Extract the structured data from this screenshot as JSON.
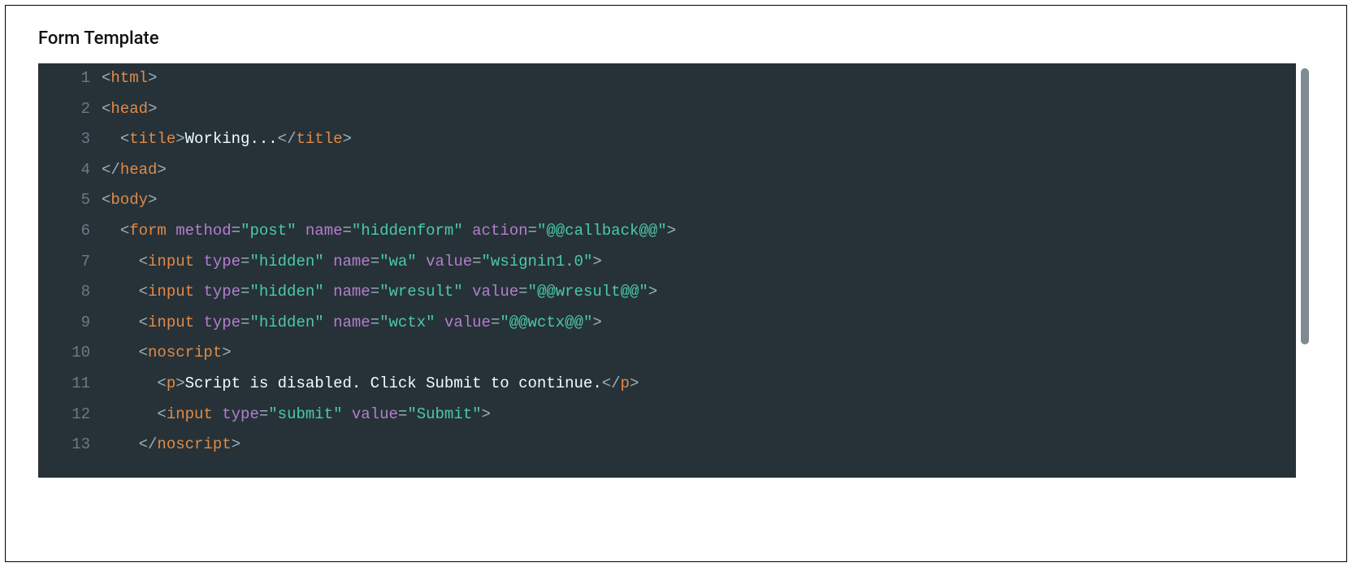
{
  "section_title": "Form Template",
  "code": {
    "lines": [
      {
        "n": "1",
        "indent": 0,
        "tokens": [
          {
            "c": "punct",
            "t": "<"
          },
          {
            "c": "tag",
            "t": "html"
          },
          {
            "c": "punct",
            "t": ">"
          }
        ]
      },
      {
        "n": "2",
        "indent": 0,
        "tokens": [
          {
            "c": "punct",
            "t": "<"
          },
          {
            "c": "tag",
            "t": "head"
          },
          {
            "c": "punct",
            "t": ">"
          }
        ]
      },
      {
        "n": "3",
        "indent": 2,
        "tokens": [
          {
            "c": "punct",
            "t": "<"
          },
          {
            "c": "tag",
            "t": "title"
          },
          {
            "c": "punct",
            "t": ">"
          },
          {
            "c": "text",
            "t": "Working..."
          },
          {
            "c": "punct",
            "t": "</"
          },
          {
            "c": "tag",
            "t": "title"
          },
          {
            "c": "punct",
            "t": ">"
          }
        ]
      },
      {
        "n": "4",
        "indent": 0,
        "tokens": [
          {
            "c": "punct",
            "t": "</"
          },
          {
            "c": "tag",
            "t": "head"
          },
          {
            "c": "punct",
            "t": ">"
          }
        ]
      },
      {
        "n": "5",
        "indent": 0,
        "tokens": [
          {
            "c": "punct",
            "t": "<"
          },
          {
            "c": "tag",
            "t": "body"
          },
          {
            "c": "punct",
            "t": ">"
          }
        ]
      },
      {
        "n": "6",
        "indent": 2,
        "tokens": [
          {
            "c": "punct",
            "t": "<"
          },
          {
            "c": "tag",
            "t": "form"
          },
          {
            "c": "text",
            "t": " "
          },
          {
            "c": "attr",
            "t": "method"
          },
          {
            "c": "punct",
            "t": "="
          },
          {
            "c": "string",
            "t": "\"post\""
          },
          {
            "c": "text",
            "t": " "
          },
          {
            "c": "attr",
            "t": "name"
          },
          {
            "c": "punct",
            "t": "="
          },
          {
            "c": "string",
            "t": "\"hiddenform\""
          },
          {
            "c": "text",
            "t": " "
          },
          {
            "c": "attr",
            "t": "action"
          },
          {
            "c": "punct",
            "t": "="
          },
          {
            "c": "string",
            "t": "\"@@callback@@\""
          },
          {
            "c": "punct",
            "t": ">"
          }
        ]
      },
      {
        "n": "7",
        "indent": 4,
        "tokens": [
          {
            "c": "punct",
            "t": "<"
          },
          {
            "c": "tag",
            "t": "input"
          },
          {
            "c": "text",
            "t": " "
          },
          {
            "c": "attr",
            "t": "type"
          },
          {
            "c": "punct",
            "t": "="
          },
          {
            "c": "string",
            "t": "\"hidden\""
          },
          {
            "c": "text",
            "t": " "
          },
          {
            "c": "attr",
            "t": "name"
          },
          {
            "c": "punct",
            "t": "="
          },
          {
            "c": "string",
            "t": "\"wa\""
          },
          {
            "c": "text",
            "t": " "
          },
          {
            "c": "attr",
            "t": "value"
          },
          {
            "c": "punct",
            "t": "="
          },
          {
            "c": "string",
            "t": "\"wsignin1.0\""
          },
          {
            "c": "punct",
            "t": ">"
          }
        ]
      },
      {
        "n": "8",
        "indent": 4,
        "tokens": [
          {
            "c": "punct",
            "t": "<"
          },
          {
            "c": "tag",
            "t": "input"
          },
          {
            "c": "text",
            "t": " "
          },
          {
            "c": "attr",
            "t": "type"
          },
          {
            "c": "punct",
            "t": "="
          },
          {
            "c": "string",
            "t": "\"hidden\""
          },
          {
            "c": "text",
            "t": " "
          },
          {
            "c": "attr",
            "t": "name"
          },
          {
            "c": "punct",
            "t": "="
          },
          {
            "c": "string",
            "t": "\"wresult\""
          },
          {
            "c": "text",
            "t": " "
          },
          {
            "c": "attr",
            "t": "value"
          },
          {
            "c": "punct",
            "t": "="
          },
          {
            "c": "string",
            "t": "\"@@wresult@@\""
          },
          {
            "c": "punct",
            "t": ">"
          }
        ]
      },
      {
        "n": "9",
        "indent": 4,
        "tokens": [
          {
            "c": "punct",
            "t": "<"
          },
          {
            "c": "tag",
            "t": "input"
          },
          {
            "c": "text",
            "t": " "
          },
          {
            "c": "attr",
            "t": "type"
          },
          {
            "c": "punct",
            "t": "="
          },
          {
            "c": "string",
            "t": "\"hidden\""
          },
          {
            "c": "text",
            "t": " "
          },
          {
            "c": "attr",
            "t": "name"
          },
          {
            "c": "punct",
            "t": "="
          },
          {
            "c": "string",
            "t": "\"wctx\""
          },
          {
            "c": "text",
            "t": " "
          },
          {
            "c": "attr",
            "t": "value"
          },
          {
            "c": "punct",
            "t": "="
          },
          {
            "c": "string",
            "t": "\"@@wctx@@\""
          },
          {
            "c": "punct",
            "t": ">"
          }
        ]
      },
      {
        "n": "10",
        "indent": 4,
        "tokens": [
          {
            "c": "punct",
            "t": "<"
          },
          {
            "c": "tag",
            "t": "noscript"
          },
          {
            "c": "punct",
            "t": ">"
          }
        ]
      },
      {
        "n": "11",
        "indent": 6,
        "tokens": [
          {
            "c": "punct",
            "t": "<"
          },
          {
            "c": "tag",
            "t": "p"
          },
          {
            "c": "punct",
            "t": ">"
          },
          {
            "c": "text",
            "t": "Script is disabled. Click Submit to continue."
          },
          {
            "c": "punct",
            "t": "</"
          },
          {
            "c": "tag",
            "t": "p"
          },
          {
            "c": "punct",
            "t": ">"
          }
        ]
      },
      {
        "n": "12",
        "indent": 6,
        "tokens": [
          {
            "c": "punct",
            "t": "<"
          },
          {
            "c": "tag",
            "t": "input"
          },
          {
            "c": "text",
            "t": " "
          },
          {
            "c": "attr",
            "t": "type"
          },
          {
            "c": "punct",
            "t": "="
          },
          {
            "c": "string",
            "t": "\"submit\""
          },
          {
            "c": "text",
            "t": " "
          },
          {
            "c": "attr",
            "t": "value"
          },
          {
            "c": "punct",
            "t": "="
          },
          {
            "c": "string",
            "t": "\"Submit\""
          },
          {
            "c": "punct",
            "t": ">"
          }
        ]
      },
      {
        "n": "13",
        "indent": 4,
        "tokens": [
          {
            "c": "punct",
            "t": "</"
          },
          {
            "c": "tag",
            "t": "noscript"
          },
          {
            "c": "punct",
            "t": ">"
          }
        ]
      }
    ]
  }
}
